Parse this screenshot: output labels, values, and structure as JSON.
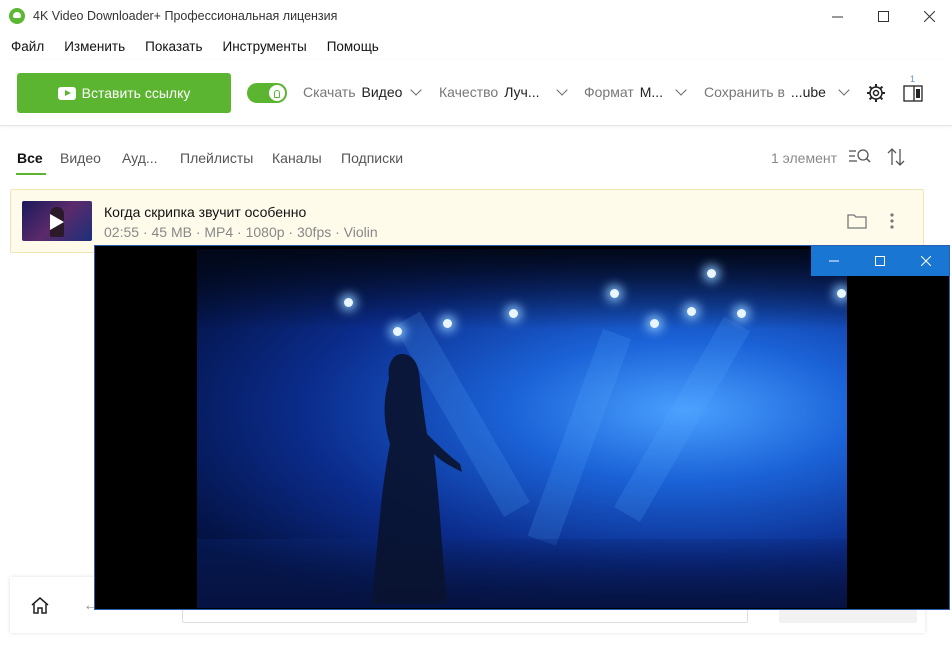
{
  "window": {
    "title": "4K Video Downloader+ Профессиональная лицензия",
    "minimize_icon": "minimize-icon",
    "maximize_icon": "maximize-icon",
    "close_icon": "close-icon"
  },
  "menu": [
    "Файл",
    "Изменить",
    "Показать",
    "Инструменты",
    "Помощь"
  ],
  "toolbar": {
    "paste_label": "Вставить ссылку",
    "toggle_on": true,
    "download_label": "Скачать",
    "download_value": "Видео",
    "quality_label": "Качество",
    "quality_value": "Луч...",
    "format_label": "Формат",
    "format_value": "М...",
    "save_label": "Сохранить в",
    "save_value": "...ube",
    "subscription_badge": "1"
  },
  "tabs": [
    "Все",
    "Видео",
    "Ауд...",
    "Плейлисты",
    "Каналы",
    "Подписки"
  ],
  "active_tab": "Все",
  "item_count": "1 элемент",
  "items": [
    {
      "title": "Когда скрипка звучит особенно",
      "meta": "02:55 · 45 MB · MP4 · 1080p · 30fps · Violin"
    }
  ],
  "colors": {
    "accent": "#5cb531",
    "item_highlight": "#fefbea",
    "player_titlebar": "#1976d2"
  }
}
